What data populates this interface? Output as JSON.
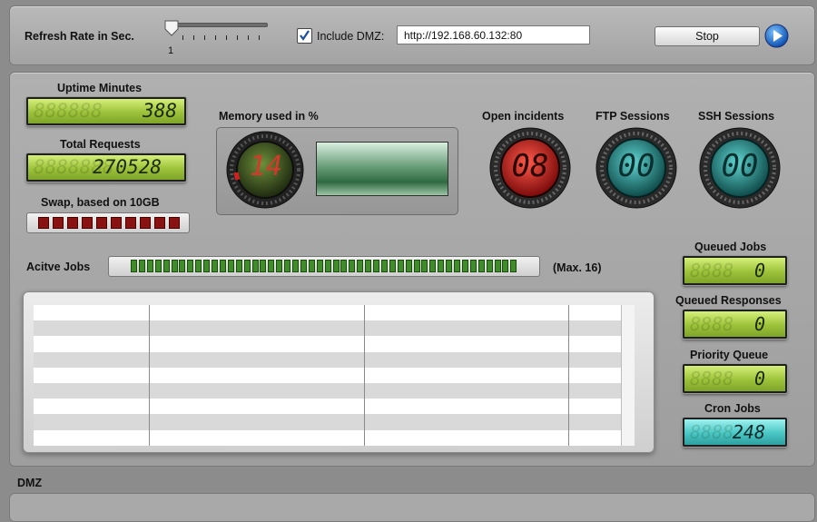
{
  "toolbar": {
    "refresh_label": "Refresh Rate in Sec.",
    "refresh_value": "1",
    "include_dmz_label": "Include DMZ:",
    "include_dmz_checked": true,
    "url": "http://192.168.60.132:80",
    "stop_label": "Stop",
    "play_icon": "play-icon"
  },
  "metrics": {
    "uptime_label": "Uptime Minutes",
    "uptime_value": "388",
    "total_requests_label": "Total Requests",
    "total_requests_value": "270528",
    "swap_label": "Swap, based on 10GB",
    "memory_label": "Memory used in %",
    "memory_value": "14",
    "open_incidents_label": "Open incidents",
    "open_incidents_value": "08",
    "ftp_label": "FTP Sessions",
    "ftp_value": "00",
    "ssh_label": "SSH Sessions",
    "ssh_value": "00"
  },
  "jobs": {
    "active_label": "Acitve Jobs",
    "max_label": "(Max. 16)"
  },
  "queues": {
    "queued_jobs_label": "Queued Jobs",
    "queued_jobs_value": "0",
    "queued_responses_label": "Queued Responses",
    "queued_responses_value": "0",
    "priority_queue_label": "Priority Queue",
    "priority_queue_value": "0",
    "cron_jobs_label": "Cron Jobs",
    "cron_jobs_value": "248"
  },
  "dmz": {
    "title": "DMZ"
  },
  "colors": {
    "lcd_green": "#9dc23a",
    "lcd_cyan": "#48c6c4",
    "incident_red": "#c41e1e",
    "active_green": "#3f8d28",
    "swap_red": "#8b1212"
  }
}
